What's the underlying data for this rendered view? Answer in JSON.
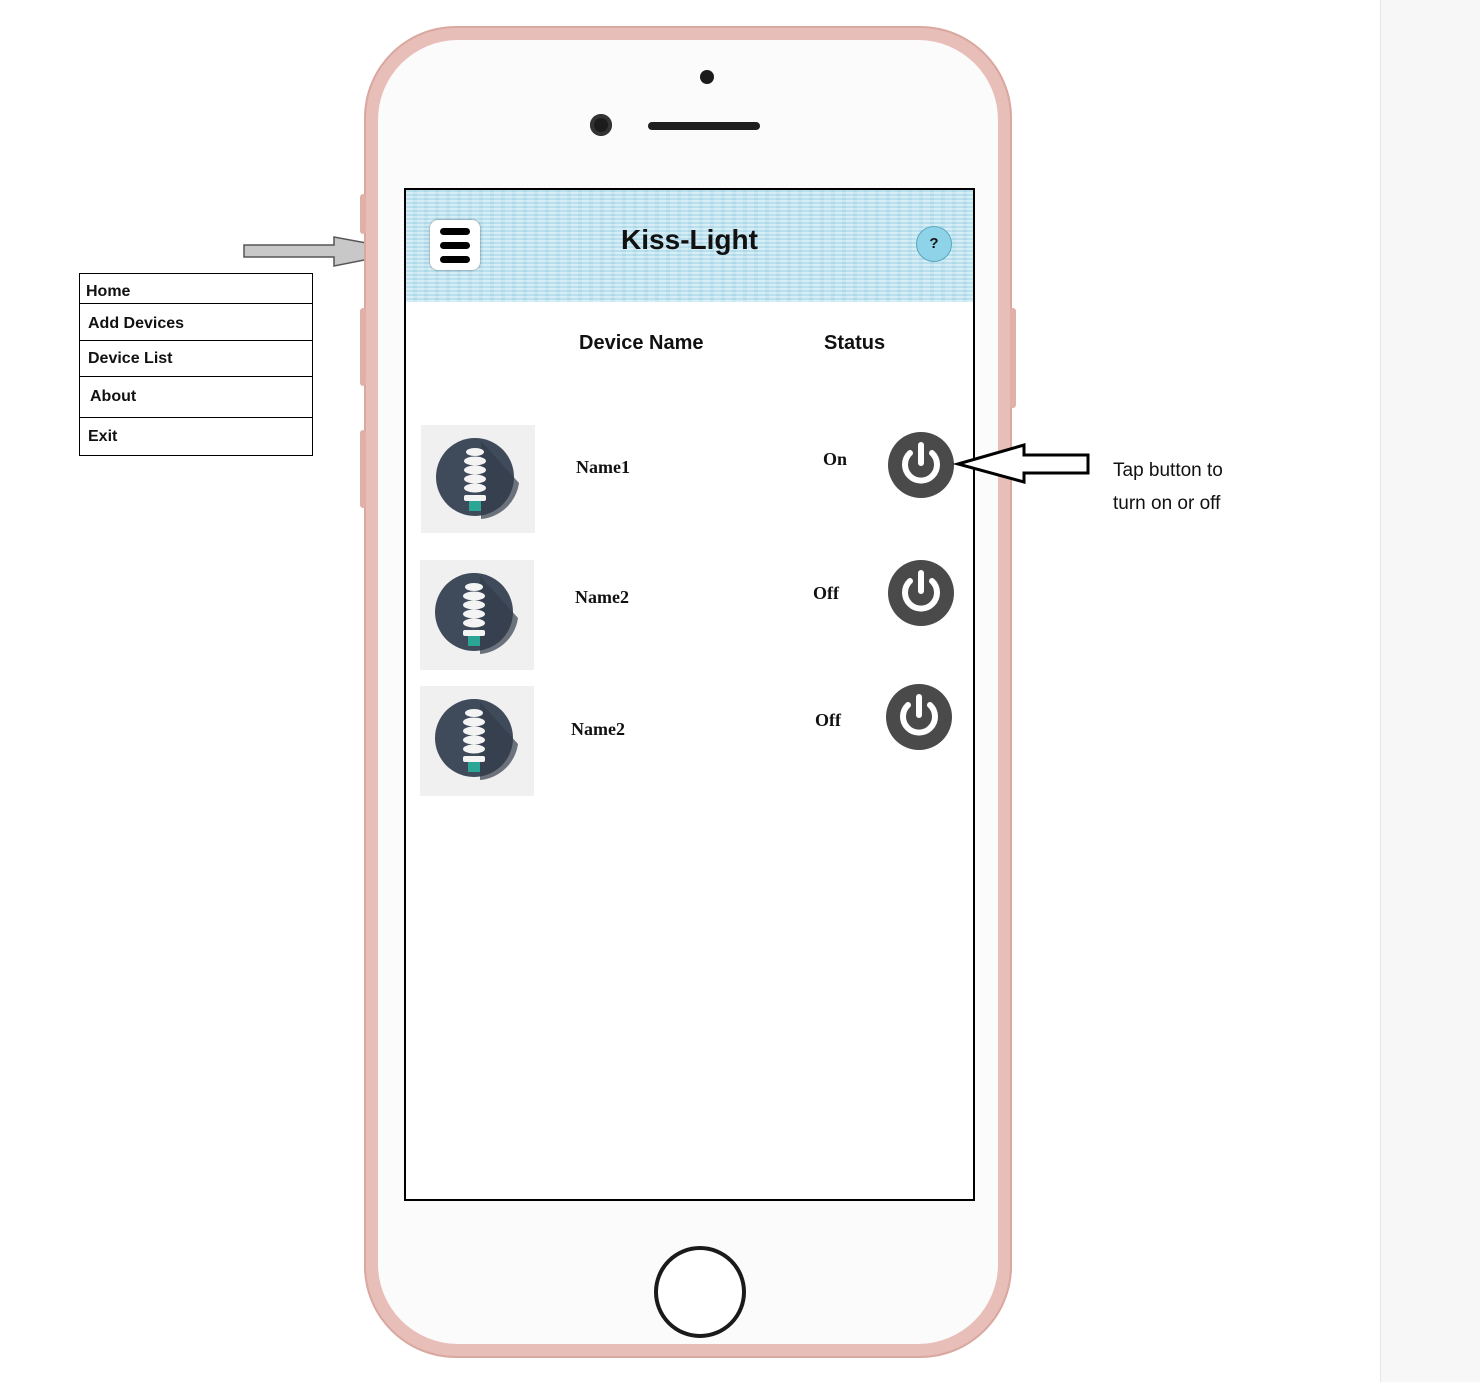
{
  "app": {
    "title": "Kiss-Light",
    "help_label": "?"
  },
  "table": {
    "headers": {
      "device_name": "Device Name",
      "status": "Status"
    },
    "rows": [
      {
        "name": "Name1",
        "status": "On"
      },
      {
        "name": "Name2",
        "status": "Off"
      },
      {
        "name": "Name2",
        "status": "Off"
      }
    ]
  },
  "side_menu": {
    "items": [
      "Home",
      "Add Devices",
      "Device List",
      "About",
      "Exit"
    ]
  },
  "annotations": {
    "power_hint_line1": "Tap button to",
    "power_hint_line2": "turn on or off"
  },
  "icons": {
    "menu": "hamburger-icon",
    "help": "help-icon",
    "device": "light-bulb-icon",
    "toggle": "power-icon"
  },
  "colors": {
    "phone_frame": "#e7bfb8",
    "header_bg": "#b9e0ee",
    "help_button": "#8fd3e8",
    "power_button": "#4a4a4a",
    "bulb_circle": "#3f4a5a"
  }
}
